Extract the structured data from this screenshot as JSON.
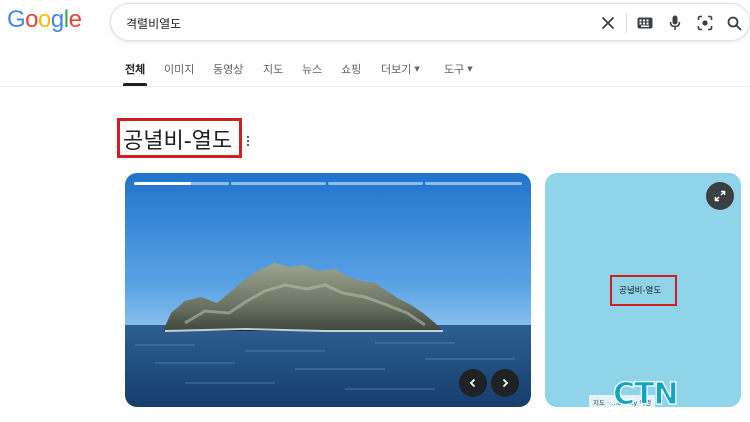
{
  "logo": {
    "text": "Google",
    "letters": [
      "G",
      "o",
      "o",
      "g",
      "l",
      "e"
    ],
    "colors": [
      "#4285F4",
      "#EA4335",
      "#FBBC05",
      "#4285F4",
      "#34A853",
      "#EA4335"
    ]
  },
  "search": {
    "query": "격렬비열도",
    "icons": [
      "close-icon",
      "keyboard-icon",
      "mic-icon",
      "lens-icon",
      "search-icon"
    ]
  },
  "tabs": [
    {
      "label": "전체",
      "active": true
    },
    {
      "label": "이미지"
    },
    {
      "label": "동영상"
    },
    {
      "label": "지도"
    },
    {
      "label": "뉴스"
    },
    {
      "label": "쇼핑"
    },
    {
      "label": "더보기",
      "dropdown": true
    },
    {
      "label": "도구",
      "dropdown": true
    }
  ],
  "entity": {
    "title": "공녈비-열도"
  },
  "carousel": {
    "slides": 4,
    "current": 1,
    "progress_fraction": 0.6
  },
  "map": {
    "label": "공녈비-열도",
    "attribution": "지도 · ...obility  약관"
  },
  "watermark": {
    "text": "CTN"
  },
  "colors": {
    "highlight_box": "#d01f22",
    "map_water": "#8fd4e8",
    "watermark": "#11a4c4"
  }
}
